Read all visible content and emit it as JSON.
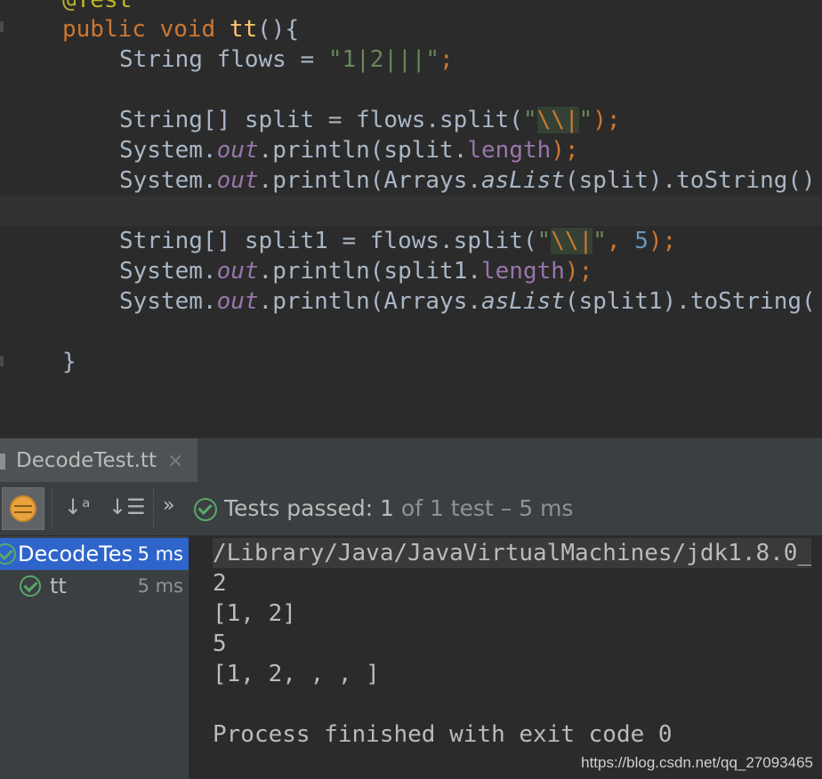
{
  "editor": {
    "lines": {
      "annotation": "@Test",
      "sig_kw": "public void",
      "sig_name": "tt",
      "sig_rest": "(){",
      "l1_type": "String flows = ",
      "l1_str": "\"1|2|||\"",
      "l1_end": ";",
      "l2_a": "String[] split = flows.split(",
      "l2_q1": "\"",
      "l2_esc": "\\\\|",
      "l2_q2": "\"",
      "l2_end": ");",
      "l3_a": "System.",
      "l3_out": "out",
      "l3_b": ".println(split.",
      "l3_len": "length",
      "l3_end": ");",
      "l4_a": "System.",
      "l4_out": "out",
      "l4_b": ".println(Arrays.",
      "l4_aslist": "asList",
      "l4_c": "(split).toString()",
      "l5_a": "String[] split1 = flows.split(",
      "l5_q1": "\"",
      "l5_esc": "\\\\|",
      "l5_q2": "\"",
      "l5_comma": ", ",
      "l5_num": "5",
      "l5_end": ");",
      "l6_a": "System.",
      "l6_out": "out",
      "l6_b": ".println(split1.",
      "l6_len": "length",
      "l6_end": ");",
      "l7_a": "System.",
      "l7_out": "out",
      "l7_b": ".println(Arrays.",
      "l7_aslist": "asList",
      "l7_c": "(split1).toString(",
      "close_brace": "}"
    }
  },
  "run": {
    "tab_label": "DecodeTest.tt",
    "tab_close": "×",
    "sort_alpha_icon": "↓ᵃ",
    "sort_duration_icon": "↓☰",
    "more_icon": "»",
    "status": {
      "prefix": "Tests passed: ",
      "passed": "1",
      "of_text": " of 1 test",
      "time": " – 5 ms"
    },
    "tree": [
      {
        "label": "DecodeTes",
        "duration": "5 ms"
      },
      {
        "label": "tt",
        "duration": "5 ms"
      }
    ],
    "console": [
      "/Library/Java/JavaVirtualMachines/jdk1.8.0_",
      "2",
      "[1, 2]",
      "5",
      "[1, 2, , , ]",
      "",
      "Process finished with exit code 0"
    ]
  },
  "watermark": "https://blog.csdn.net/qq_27093465",
  "colors": {
    "editor_bg": "#2b2b2b",
    "keyword": "#cc7832",
    "string": "#6a8759",
    "field": "#9876aa",
    "number": "#6897bb",
    "selection": "#2f65ca",
    "pass_green": "#59a869"
  }
}
